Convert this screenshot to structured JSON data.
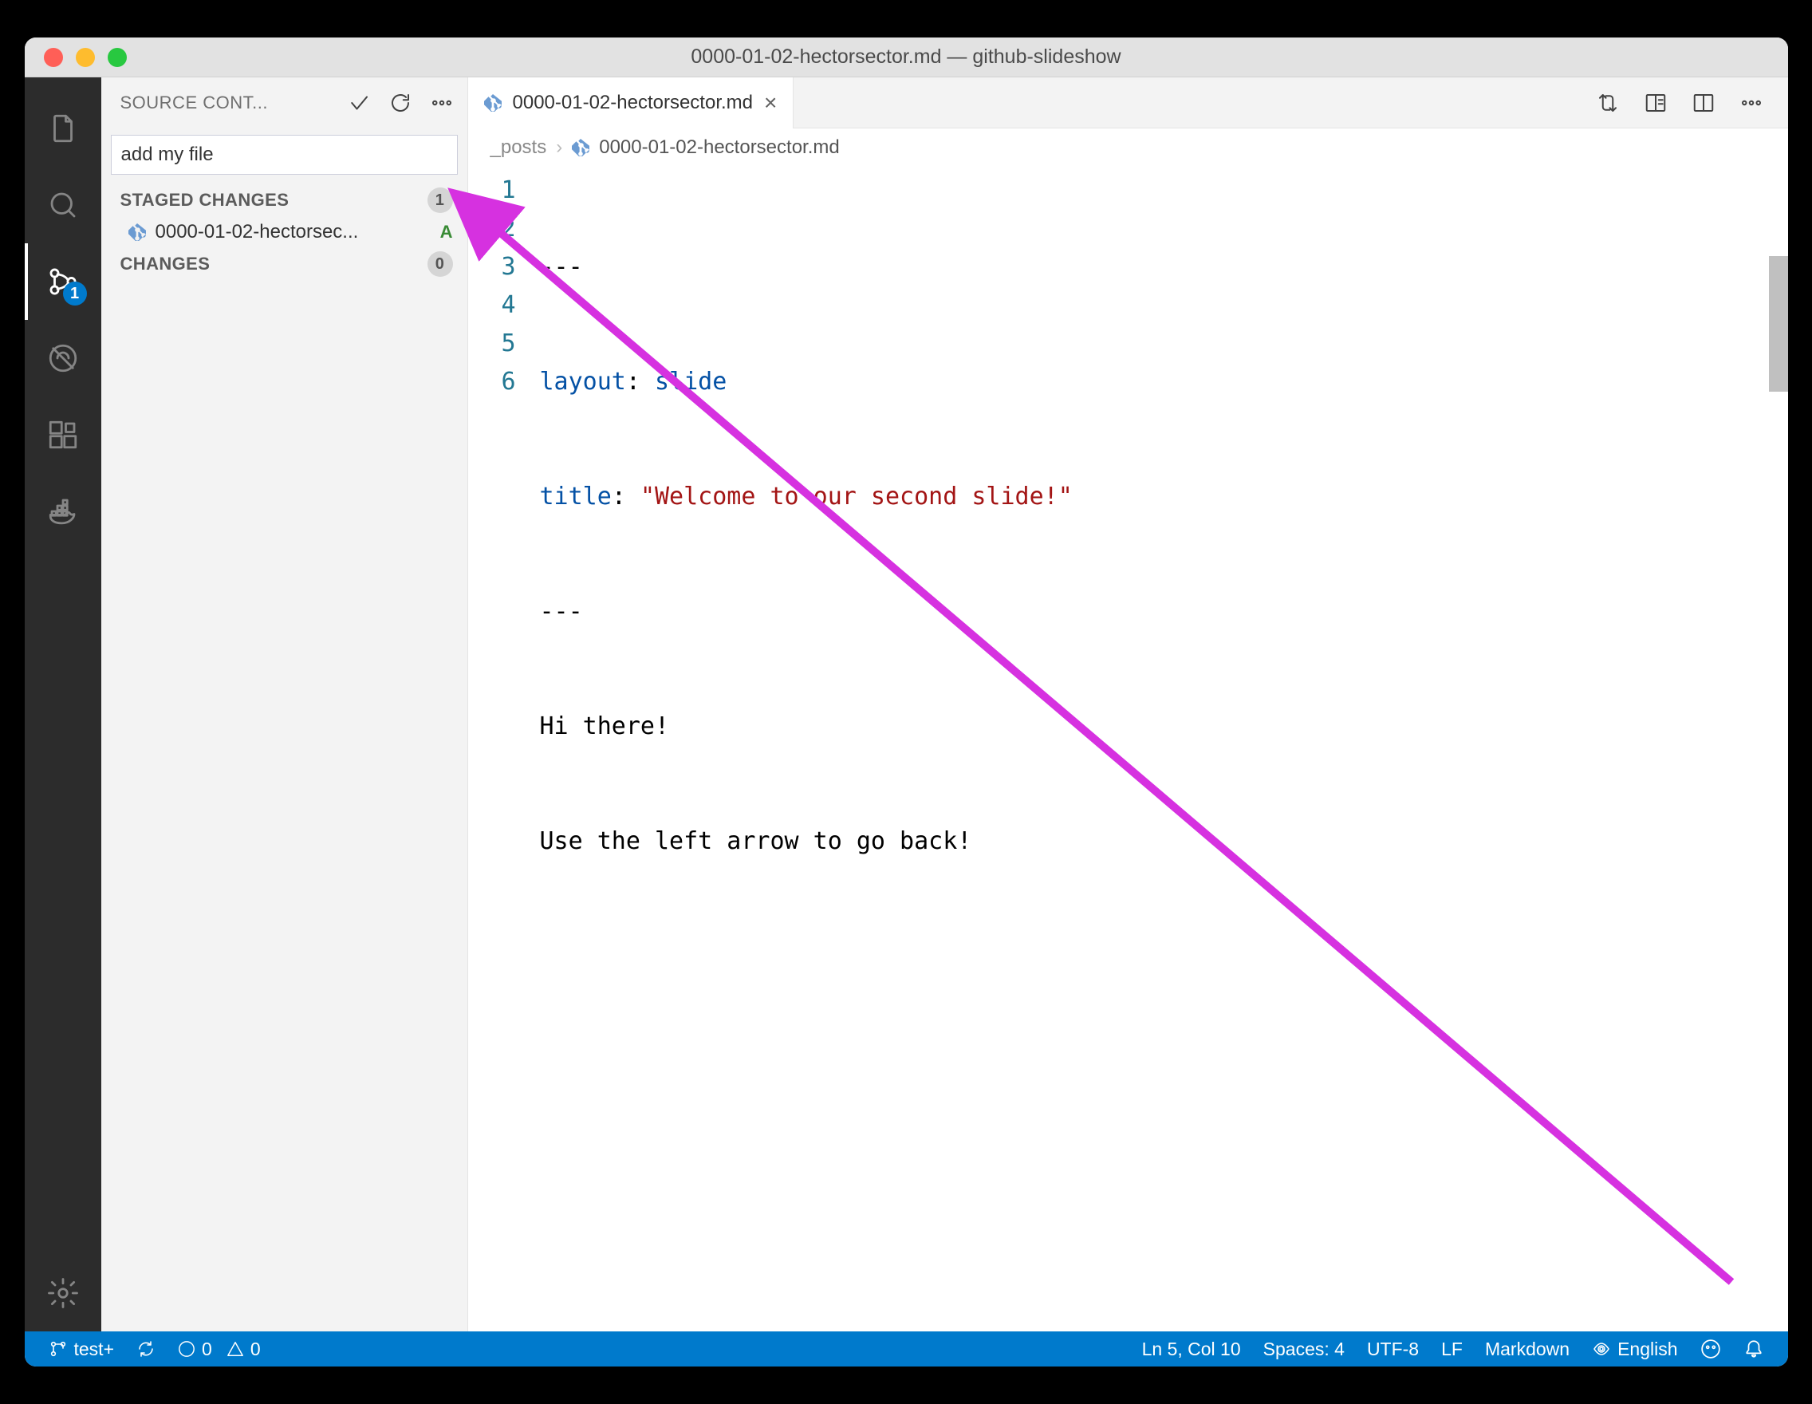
{
  "window_title": "0000-01-02-hectorsector.md — github-slideshow",
  "activity_bar": {
    "scm_badge": "1"
  },
  "scm": {
    "panel_title": "SOURCE CONT...",
    "commit_message": "add my file",
    "staged_label": "STAGED CHANGES",
    "staged_count": "1",
    "staged_file": "0000-01-02-hectorsec...",
    "staged_status": "A",
    "changes_label": "CHANGES",
    "changes_count": "0"
  },
  "tab": {
    "file_name": "0000-01-02-hectorsector.md"
  },
  "breadcrumbs": {
    "folder": "_posts",
    "file": "0000-01-02-hectorsector.md"
  },
  "code_lines": {
    "l1": "---",
    "l2a": "layout",
    "l2b": ": ",
    "l2c": "slide",
    "l3a": "title",
    "l3b": ": ",
    "l3c": "\"Welcome to our second slide!\"",
    "l4": "---",
    "l5": "Hi there!",
    "l6": "Use the left arrow to go back!"
  },
  "status": {
    "branch": "test+",
    "errors": "0",
    "warnings": "0",
    "pos": "Ln 5, Col 10",
    "spaces": "Spaces: 4",
    "encoding": "UTF-8",
    "eol": "LF",
    "lang": "Markdown",
    "spell": "English"
  }
}
